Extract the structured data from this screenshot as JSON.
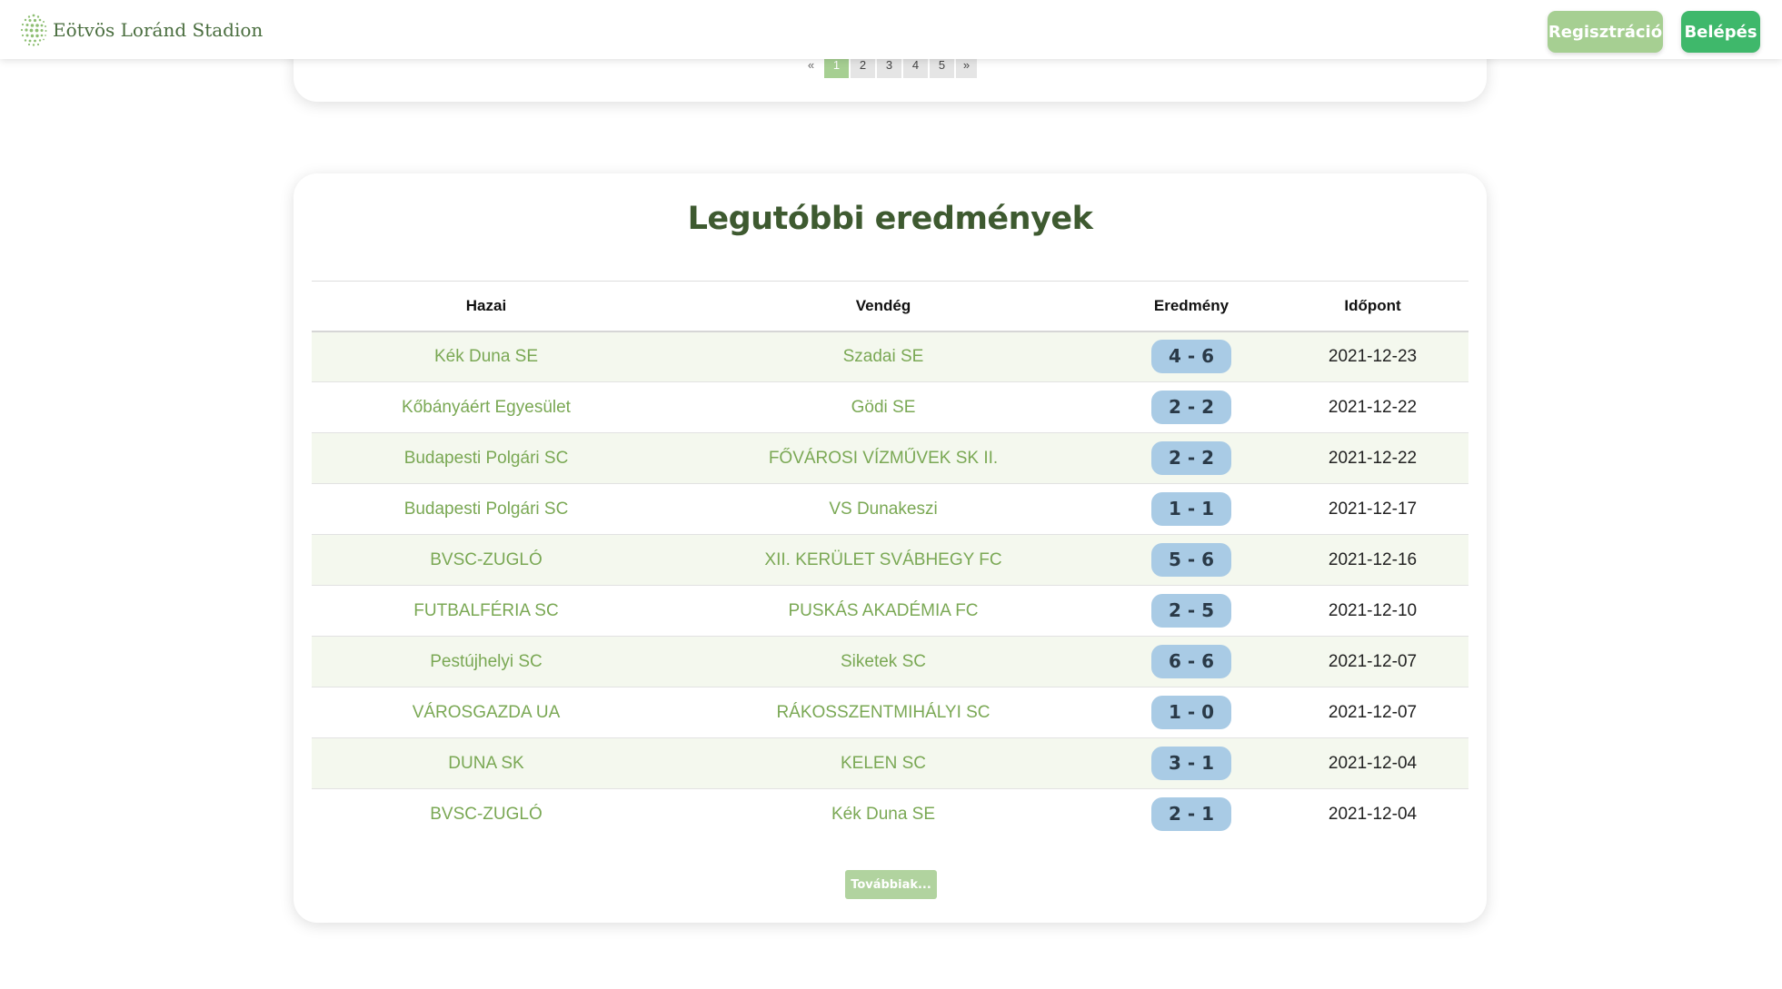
{
  "header": {
    "brand_name": "Eötvös Loránd Stadion",
    "register_label": "Regisztráció",
    "login_label": "Belépés"
  },
  "pagination": {
    "prev_label": "«",
    "pages": [
      "1",
      "2",
      "3",
      "4",
      "5"
    ],
    "active_page": "1",
    "next_label": "»"
  },
  "results": {
    "title": "Legutóbbi eredmények",
    "columns": [
      "Hazai",
      "Vendég",
      "Eredmény",
      "Időpont"
    ],
    "rows": [
      {
        "home": "Kék Duna SE",
        "away": "Szadai SE",
        "score": "4 - 6",
        "date": "2021-12-23"
      },
      {
        "home": "Kőbányáért Egyesület",
        "away": "Gödi SE",
        "score": "2 - 2",
        "date": "2021-12-22"
      },
      {
        "home": "Budapesti Polgári SC",
        "away": "FŐVÁROSI VÍZMŰVEK SK II.",
        "score": "2 - 2",
        "date": "2021-12-22"
      },
      {
        "home": "Budapesti Polgári SC",
        "away": "VS Dunakeszi",
        "score": "1 - 1",
        "date": "2021-12-17"
      },
      {
        "home": "BVSC-ZUGLÓ",
        "away": "XII. KERÜLET SVÁBHEGY FC",
        "score": "5 - 6",
        "date": "2021-12-16"
      },
      {
        "home": "FUTBALFÉRIA SC",
        "away": "PUSKÁS AKADÉMIA FC",
        "score": "2 - 5",
        "date": "2021-12-10"
      },
      {
        "home": "Pestújhelyi SC",
        "away": "Siketek SC",
        "score": "6 - 6",
        "date": "2021-12-07"
      },
      {
        "home": "VÁROSGAZDA UA",
        "away": "RÁKOSSZENTMIHÁLYI SC",
        "score": "1 - 0",
        "date": "2021-12-07"
      },
      {
        "home": "DUNA SK",
        "away": "KELEN SC",
        "score": "3 - 1",
        "date": "2021-12-04"
      },
      {
        "home": "BVSC-ZUGLÓ",
        "away": "Kék Duna SE",
        "score": "2 - 1",
        "date": "2021-12-04"
      }
    ],
    "more_label": "Továbbiak..."
  },
  "colors": {
    "brand_green": "#4a6e3f",
    "register_bg": "#a6cf92",
    "login_bg": "#3fb86b",
    "team_link": "#7aa854",
    "score_badge": "#a9cbe5",
    "row_stripe": "#f4f8ee"
  },
  "icons": {
    "logo": "globe-dots-logo-icon"
  }
}
